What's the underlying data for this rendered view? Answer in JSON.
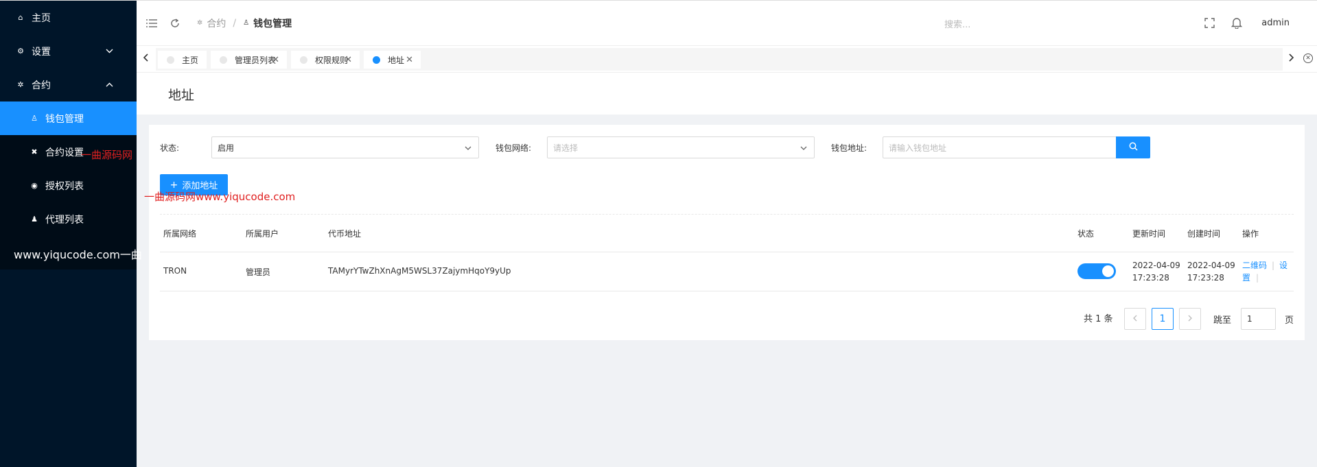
{
  "sidebar": {
    "items": [
      {
        "label": "主页",
        "icon": "home-icon"
      },
      {
        "label": "设置",
        "icon": "gear-icon"
      },
      {
        "label": "合约",
        "icon": "contract-icon"
      }
    ],
    "submenu": [
      {
        "label": "钱包管理",
        "icon": "wallet-icon"
      },
      {
        "label": "合约设置",
        "icon": "tools-icon"
      },
      {
        "label": "授权列表",
        "icon": "auth-icon"
      },
      {
        "label": "代理列表",
        "icon": "user-icon"
      }
    ]
  },
  "watermarks": {
    "w1": "一曲源码网",
    "w2": "一曲源码网www.yiqucode.com",
    "w3": "www.yiqucode.com一曲"
  },
  "header": {
    "breadcrumb": [
      "合约",
      "钱包管理"
    ],
    "search_placeholder": "搜索...",
    "user": "admin"
  },
  "tabs": [
    "主页",
    "管理员列表",
    "权限规则",
    "地址"
  ],
  "page": {
    "title": "地址"
  },
  "filters": {
    "status_label": "状态:",
    "status_value": "启用",
    "network_label": "钱包网络:",
    "network_placeholder": "请选择",
    "address_label": "钱包地址:",
    "address_placeholder": "请输入钱包地址"
  },
  "add_button": "添加地址",
  "table": {
    "headers": [
      "所属网络",
      "所属用户",
      "代币地址",
      "状态",
      "更新时间",
      "创建时间",
      "操作"
    ],
    "rows": [
      {
        "network": "TRON",
        "user": "管理员",
        "address": "TAMyrYTwZhXnAgM5WSL37ZajymHqoY9yUp",
        "status_on": true,
        "updated_date": "2022-04-09",
        "updated_time": "17:23:28",
        "created_date": "2022-04-09",
        "created_time": "17:23:28",
        "action_qr": "二维码",
        "action_set_a": "设",
        "action_set_b": "置"
      }
    ]
  },
  "pagination": {
    "total": "共 1 条",
    "current": "1",
    "goto_label": "跳至",
    "goto_value": "1",
    "page_suffix": "页"
  },
  "colors": {
    "primary": "#1890ff",
    "sidebar": "#001529"
  }
}
